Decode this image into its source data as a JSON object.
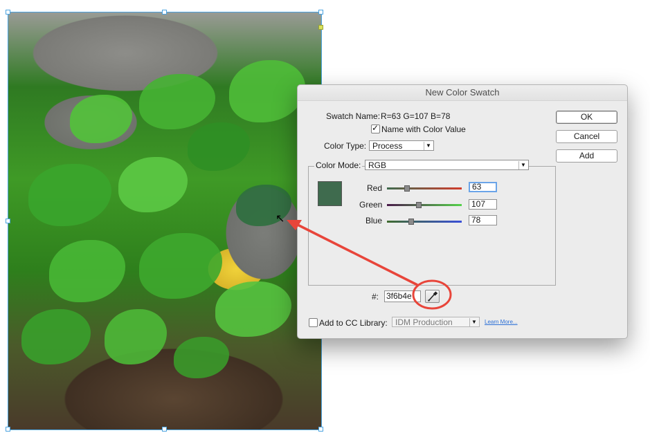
{
  "dialog": {
    "title": "New Color Swatch",
    "swatch_name_label": "Swatch Name:",
    "swatch_name_value": "R=63 G=107 B=78",
    "name_with_color_value_label": "Name with Color Value",
    "name_with_color_value_checked": true,
    "color_type_label": "Color Type:",
    "color_type_value": "Process",
    "color_mode_label": "Color Mode:",
    "color_mode_value": "RGB",
    "swatch_color": "#3f6b4e",
    "channels": [
      {
        "label": "Red",
        "value": "63",
        "max": 255
      },
      {
        "label": "Green",
        "value": "107",
        "max": 255
      },
      {
        "label": "Blue",
        "value": "78",
        "max": 255
      }
    ],
    "hex_label": "#:",
    "hex_value": "3f6b4e",
    "add_to_cc_library_label": "Add to CC Library:",
    "add_to_cc_library_checked": false,
    "library_value": "IDM Production",
    "learn_more_label": "Learn More...",
    "buttons": {
      "ok": "OK",
      "cancel": "Cancel",
      "add": "Add"
    }
  },
  "icons": {
    "eyedropper": "eyedropper-icon",
    "cursor": "pointer-cursor-icon",
    "arrow": "annotation-arrow",
    "circle": "annotation-circle"
  },
  "colors": {
    "annotation": "#e8453a",
    "accent": "#4aa3e0",
    "swatch": "#3f6b4e"
  }
}
